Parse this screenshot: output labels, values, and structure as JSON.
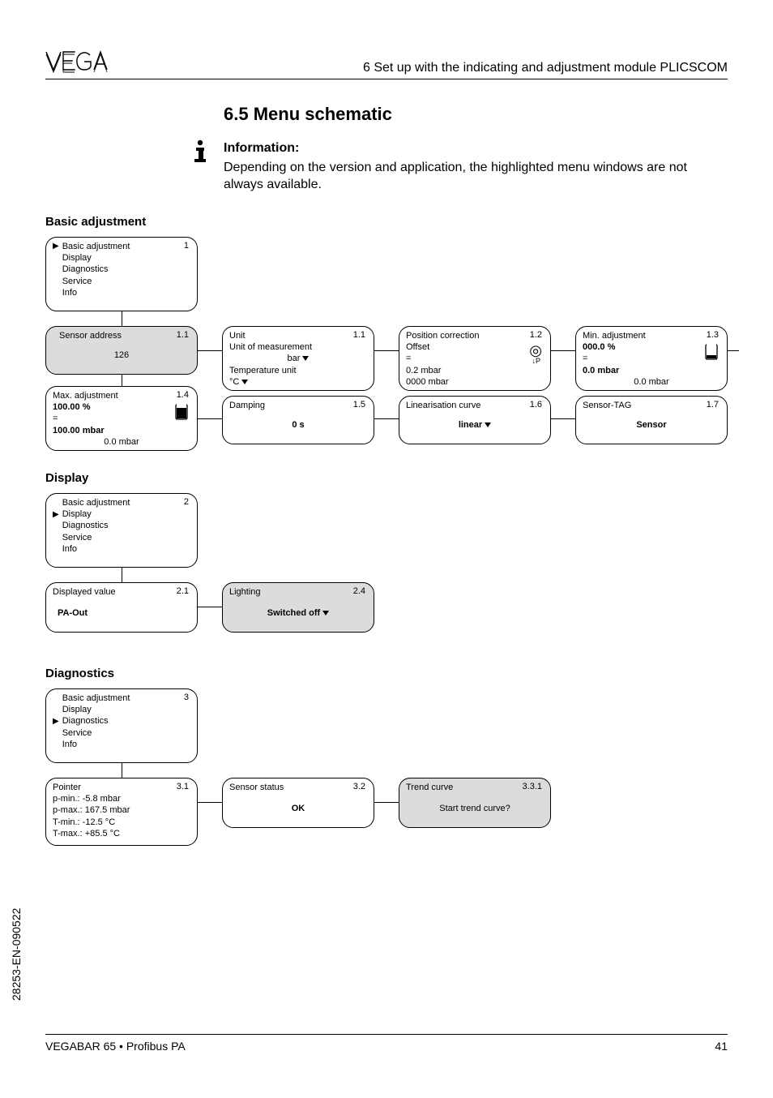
{
  "header": {
    "chapter": "6  Set up with the indicating and adjustment module PLICSCOM"
  },
  "section": {
    "number_title": "6.5   Menu schematic"
  },
  "info": {
    "heading": "Information:",
    "body": "Depending on the version and application, the highlighted menu windows are not always available."
  },
  "groups": {
    "basic": {
      "heading": "Basic adjustment",
      "root_num": "1",
      "root_items": [
        "Basic adjustment",
        "Display",
        "Diagnostics",
        "Service",
        "Info"
      ],
      "nodes": {
        "sensor_address": {
          "num": "1.1",
          "title": "Sensor address",
          "value": "126"
        },
        "unit": {
          "num": "1.1",
          "title": "Unit",
          "l1": "Unit of measurement",
          "l2": "bar",
          "l3": "Temperature unit",
          "l4": "°C"
        },
        "position": {
          "num": "1.2",
          "title": "Position correction",
          "l1": "Offset",
          "l2": "=",
          "l3": "0.2 mbar",
          "l4": "0000 mbar"
        },
        "min_adj": {
          "num": "1.3",
          "title": "Min. adjustment",
          "v1": "000.0 %",
          "v2": "=",
          "v3": "0.0 mbar",
          "v4": "0.0 mbar"
        },
        "max_adj": {
          "num": "1.4",
          "title": "Max. adjustment",
          "v1": "100.00 %",
          "v2": "=",
          "v3": "100.00 mbar",
          "v4": "0.0 mbar"
        },
        "damping": {
          "num": "1.5",
          "title": "Damping",
          "value": "0 s"
        },
        "linearisation": {
          "num": "1.6",
          "title": "Linearisation curve",
          "value": "linear"
        },
        "sensor_tag": {
          "num": "1.7",
          "title": "Sensor-TAG",
          "value": "Sensor"
        }
      }
    },
    "display": {
      "heading": "Display",
      "root_num": "2",
      "root_items": [
        "Basic adjustment",
        "Display",
        "Diagnostics",
        "Service",
        "Info"
      ],
      "nodes": {
        "displayed_value": {
          "num": "2.1",
          "title": "Displayed value",
          "value": "PA-Out"
        },
        "lighting": {
          "num": "2.4",
          "title": "Lighting",
          "value": "Switched off"
        }
      }
    },
    "diagnostics": {
      "heading": "Diagnostics",
      "root_num": "3",
      "root_items": [
        "Basic adjustment",
        "Display",
        "Diagnostics",
        "Service",
        "Info"
      ],
      "nodes": {
        "pointer": {
          "num": "3.1",
          "title": "Pointer",
          "l1": "p-min.: -5.8 mbar",
          "l2": "p-max.: 167.5 mbar",
          "l3": "T-min.: -12.5 °C",
          "l4": "T-max.: +85.5 °C"
        },
        "sensor_status": {
          "num": "3.2",
          "title": "Sensor status",
          "value": "OK"
        },
        "trend_curve": {
          "num": "3.3.1",
          "title": "Trend curve",
          "value": "Start trend curve?"
        }
      }
    }
  },
  "footer": {
    "left": "VEGABAR 65 • Profibus PA",
    "right": "41"
  },
  "side": "28253-EN-090522"
}
